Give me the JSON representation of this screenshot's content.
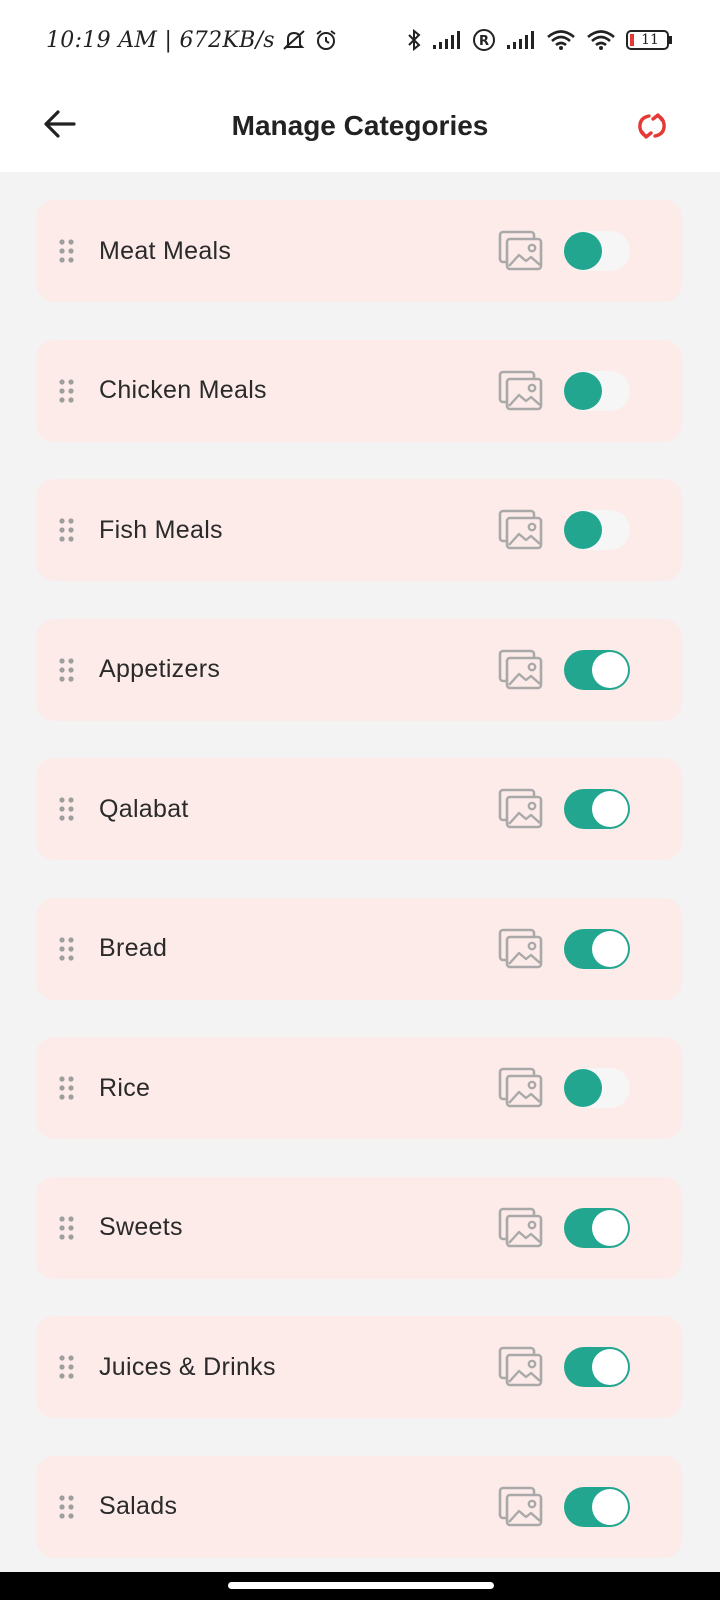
{
  "status_bar": {
    "time_speed": "10:19 AM | 672KB/s",
    "battery_level": "11",
    "icons": [
      "mute-icon",
      "alarm-icon",
      "bluetooth-icon",
      "signal-icon",
      "roaming-icon",
      "signal-icon",
      "wifi-icon",
      "wifi-icon",
      "battery-icon"
    ]
  },
  "app_bar": {
    "title": "Manage Categories",
    "back_icon": "arrow-left-icon",
    "refresh_icon": "refresh-icon",
    "accent_color": "#e53935"
  },
  "colors": {
    "card_background": "#fcebe9",
    "toggle_teal": "#22a68f",
    "page_background": "#f3f3f3"
  },
  "categories": [
    {
      "label": "Meat Meals",
      "enabled": false
    },
    {
      "label": "Chicken Meals",
      "enabled": false
    },
    {
      "label": "Fish Meals",
      "enabled": false
    },
    {
      "label": "Appetizers",
      "enabled": true
    },
    {
      "label": "Qalabat",
      "enabled": true
    },
    {
      "label": "Bread",
      "enabled": true
    },
    {
      "label": "Rice",
      "enabled": false
    },
    {
      "label": "Sweets",
      "enabled": true
    },
    {
      "label": "Juices & Drinks",
      "enabled": true
    },
    {
      "label": "Salads",
      "enabled": true
    }
  ]
}
